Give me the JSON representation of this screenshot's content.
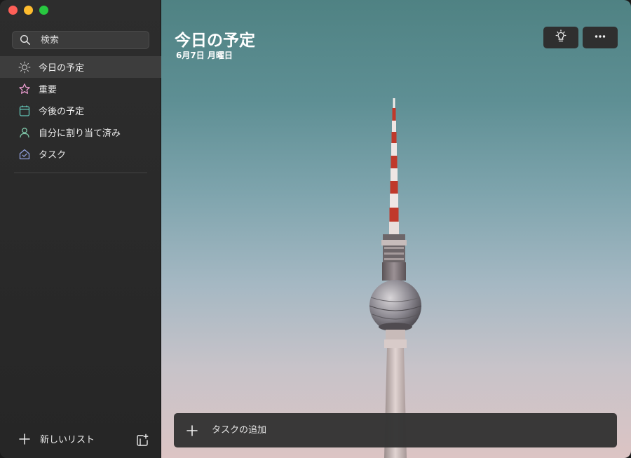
{
  "window": {
    "controls": [
      "close",
      "minimize",
      "maximize"
    ]
  },
  "sidebar": {
    "search": {
      "placeholder": "検索",
      "icon": "search-icon"
    },
    "items": [
      {
        "label": "今日の予定",
        "icon": "sun-icon",
        "active": true,
        "color": "#b9b9b9"
      },
      {
        "label": "重要",
        "icon": "star-icon",
        "active": false,
        "color": "#e59acb"
      },
      {
        "label": "今後の予定",
        "icon": "calendar-icon",
        "active": false,
        "color": "#63c4b6"
      },
      {
        "label": "自分に割り当て済み",
        "icon": "person-icon",
        "active": false,
        "color": "#7ec6a8"
      },
      {
        "label": "タスク",
        "icon": "home-check-icon",
        "active": false,
        "color": "#8f9fdc"
      }
    ],
    "new_list_label": "新しいリスト"
  },
  "main": {
    "title": "今日の予定",
    "date": "6月7日 月曜日",
    "add_task_placeholder": "タスクの追加",
    "background_icon": "tv-tower-photo"
  }
}
